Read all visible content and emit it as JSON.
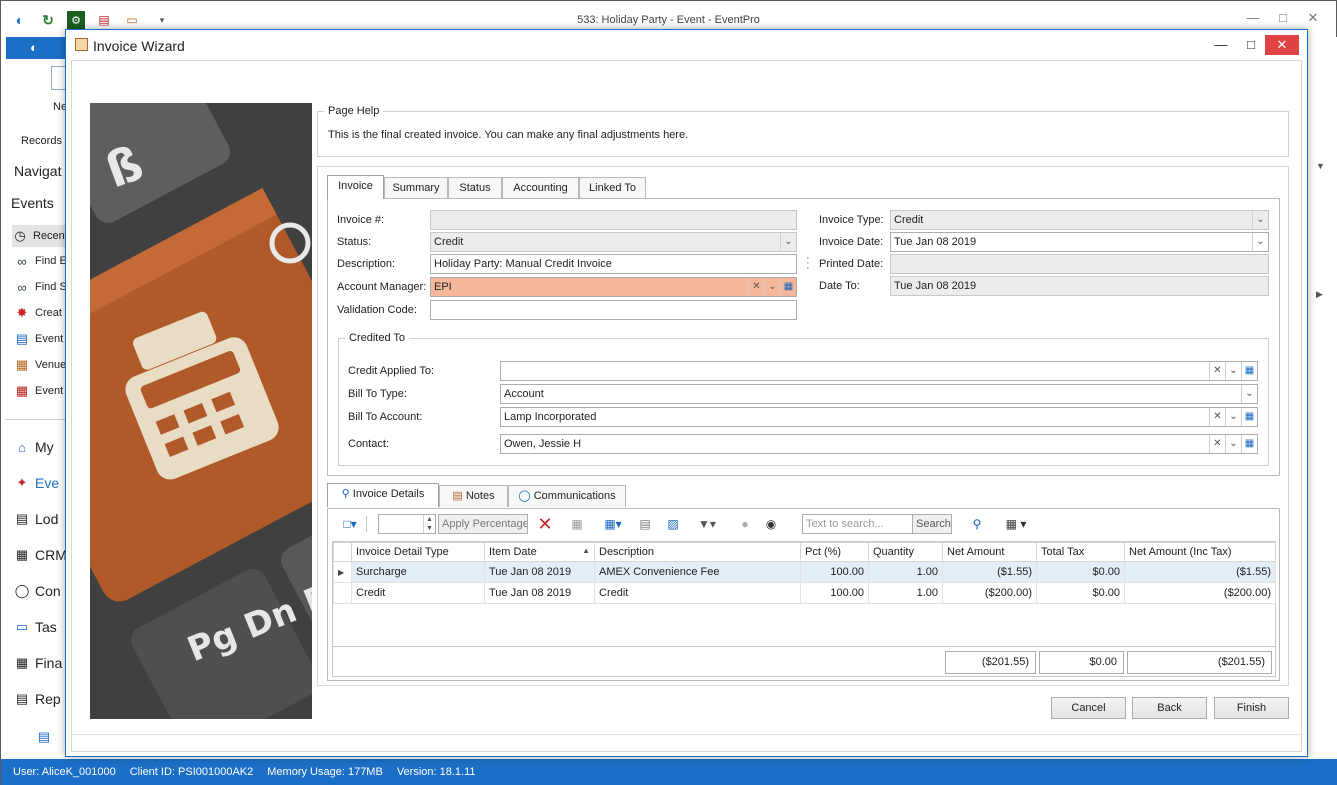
{
  "app": {
    "title": "533: Holiday Party - Event - EventPro",
    "ribbon_new_label": "Ne",
    "ribbon_records_label": "Records",
    "nav": {
      "header": "Navigat",
      "section": "Events",
      "items": [
        "Recen",
        "Find E",
        "Find S",
        "Creat",
        "Event",
        "Venue",
        "Event"
      ],
      "bottom_items": [
        "My",
        "Eve",
        "Lod",
        "CRM",
        "Con",
        "Tas",
        "Fina",
        "Rep"
      ]
    },
    "status_bar": {
      "user": "User: AliceK_001000",
      "client": "Client ID: PSI001000AK2",
      "memory": "Memory Usage: 177MB",
      "version": "Version: 18.1.11"
    }
  },
  "dialog": {
    "title": "Invoice Wizard",
    "page_help": {
      "legend": "Page Help",
      "text": "This is the final created invoice.  You can make any final adjustments here."
    },
    "tabs": [
      "Invoice",
      "Summary",
      "Status",
      "Accounting",
      "Linked To"
    ],
    "fields": {
      "invoice_no_label": "Invoice #:",
      "invoice_no_value": "",
      "status_label": "Status:",
      "status_value": "Credit",
      "description_label": "Description:",
      "description_value": "Holiday Party: Manual Credit Invoice",
      "account_manager_label": "Account Manager:",
      "account_manager_value": "EPI",
      "validation_code_label": "Validation Code:",
      "validation_code_value": "",
      "invoice_type_label": "Invoice Type:",
      "invoice_type_value": "Credit",
      "invoice_date_label": "Invoice Date:",
      "invoice_date_value": "Tue Jan 08 2019",
      "printed_date_label": "Printed Date:",
      "printed_date_value": "",
      "date_to_label": "Date To:",
      "date_to_value": "Tue Jan 08 2019"
    },
    "credited_to": {
      "legend": "Credited To",
      "credit_applied_label": "Credit Applied To:",
      "credit_applied_value": "",
      "bill_to_type_label": "Bill To Type:",
      "bill_to_type_value": "Account",
      "bill_to_account_label": "Bill To Account:",
      "bill_to_account_value": "Lamp Incorporated",
      "contact_label": "Contact:",
      "contact_value": "Owen, Jessie H"
    },
    "detail_tabs": [
      "Invoice Details",
      "Notes",
      "Communications"
    ],
    "toolbar": {
      "apply_percentage": "Apply Percentage",
      "search_placeholder": "Text to search...",
      "search_button": "Search"
    },
    "grid": {
      "columns": [
        "Invoice Detail Type",
        "Item Date",
        "Description",
        "Pct (%)",
        "Quantity",
        "Net Amount",
        "Total Tax",
        "Net Amount (Inc Tax)"
      ],
      "rows": [
        [
          "Surcharge",
          "Tue Jan 08 2019",
          "AMEX Convenience Fee",
          "100.00",
          "1.00",
          "($1.55)",
          "$0.00",
          "($1.55)"
        ],
        [
          "Credit",
          "Tue Jan 08 2019",
          "Credit",
          "100.00",
          "1.00",
          "($200.00)",
          "$0.00",
          "($200.00)"
        ]
      ],
      "totals": {
        "net": "($201.55)",
        "tax": "$0.00",
        "net_inc_tax": "($201.55)"
      }
    },
    "buttons": {
      "cancel": "Cancel",
      "back": "Back",
      "finish": "Finish"
    }
  },
  "colors": {
    "accent": "#1c6fc7",
    "highlight_field": "#f7b79b",
    "close_button": "#e04343"
  }
}
